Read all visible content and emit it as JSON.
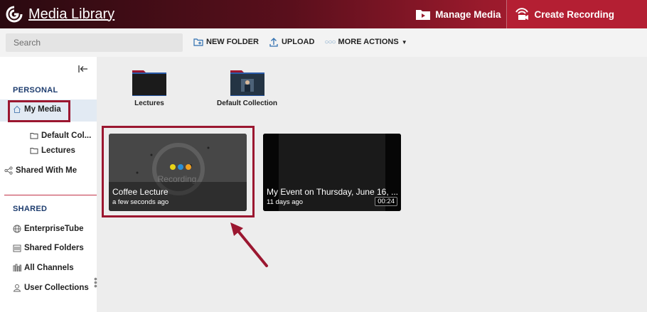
{
  "header": {
    "title": "Media Library",
    "manage_label": "Manage Media",
    "create_label": "Create Recording"
  },
  "toolbar": {
    "search_placeholder": "Search",
    "new_folder": "NEW FOLDER",
    "upload": "UPLOAD",
    "more_actions": "MORE ACTIONS"
  },
  "sidebar": {
    "personal_title": "PERSONAL",
    "my_media": "My Media",
    "default_col": "Default Col...",
    "lectures": "Lectures",
    "shared_with_me": "Shared With Me",
    "shared_title": "SHARED",
    "enterprise_tube": "EnterpriseTube",
    "shared_folders": "Shared Folders",
    "all_channels": "All Channels",
    "user_collections": "User Collections"
  },
  "folders": [
    {
      "label": "Lectures"
    },
    {
      "label": "Default Collection"
    }
  ],
  "media": [
    {
      "title": "Coffee Lecture",
      "meta": "a few seconds ago",
      "thumb_text": "Recording"
    },
    {
      "title": "My Event on Thursday, June 16, ...",
      "meta": "11 days ago",
      "duration": "00:24"
    }
  ],
  "colors": {
    "brand": "#b41f33",
    "highlight": "#9b1730",
    "nav_title": "#1d3c6e"
  }
}
